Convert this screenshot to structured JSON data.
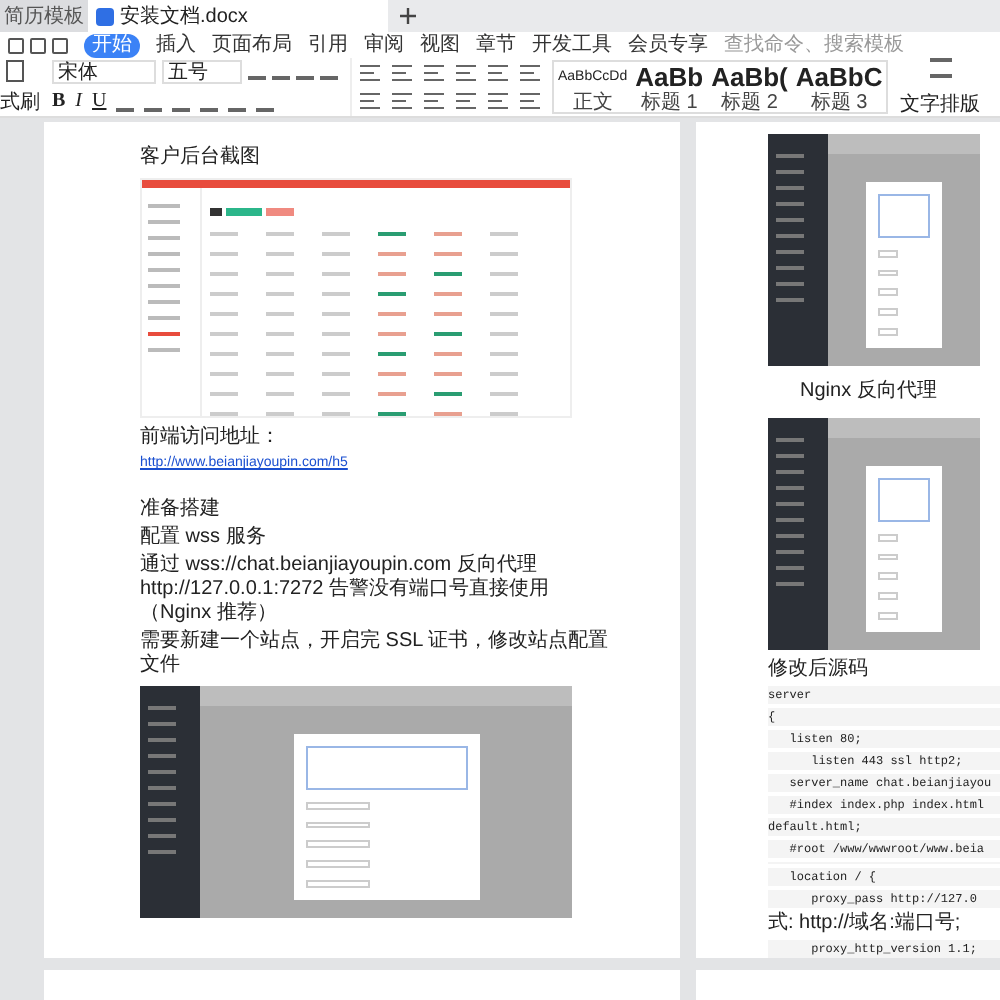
{
  "tabs": [
    {
      "label": "简历模板",
      "selected": false,
      "icon": false
    },
    {
      "label": "安装文档.docx",
      "selected": true,
      "icon": true
    }
  ],
  "menu": [
    {
      "label": "开始",
      "selected": true
    },
    {
      "label": "插入",
      "selected": false
    },
    {
      "label": "页面布局",
      "selected": false
    },
    {
      "label": "引用",
      "selected": false
    },
    {
      "label": "审阅",
      "selected": false
    },
    {
      "label": "视图",
      "selected": false
    },
    {
      "label": "章节",
      "selected": false
    },
    {
      "label": "开发工具",
      "selected": false
    },
    {
      "label": "会员专享",
      "selected": false
    }
  ],
  "search": {
    "placeholder": "查找命令、搜索模板"
  },
  "ribbon": {
    "format_painter": "式刷",
    "font": "宋体",
    "size": "五号",
    "format_buttons": [
      "B",
      "I",
      "U"
    ],
    "styles": [
      {
        "preview": "AaBbCcDd",
        "label": "正文",
        "kind": "body"
      },
      {
        "preview": "AaBb",
        "label": "标题 1",
        "kind": "heading"
      },
      {
        "preview": "AaBb(",
        "label": "标题 2",
        "kind": "heading"
      },
      {
        "preview": "AaBbC",
        "label": "标题 3",
        "kind": "heading"
      }
    ],
    "layout": "文字排版"
  },
  "page_1": [
    {
      "kind": "text",
      "text": "客户后台截图"
    },
    {
      "kind": "admin"
    },
    {
      "kind": "text",
      "text": "前端访问地址："
    },
    {
      "kind": "link",
      "text": "http://www.beianjiayoupin.com/h5"
    },
    {
      "kind": "gap"
    },
    {
      "kind": "text",
      "text": "准备搭建"
    },
    {
      "kind": "text",
      "text": "配置 wss 服务"
    },
    {
      "kind": "text",
      "text": "通过 wss://chat.beianjiayoupin.com 反向代理 http://127.0.0.1:7272 告警没有端口号直接使用（Nginx 推荐）"
    },
    {
      "kind": "text",
      "text": "需要新建一个站点，开启完 SSL 证书，修改站点配置文件"
    },
    {
      "kind": "panel"
    }
  ],
  "page_2": [
    {
      "kind": "panel"
    },
    {
      "kind": "title",
      "text": "Nginx 反向代理"
    },
    {
      "kind": "panel"
    },
    {
      "kind": "text",
      "text": "修改后源码"
    },
    {
      "kind": "code",
      "text": "server"
    },
    {
      "kind": "code",
      "text": "{"
    },
    {
      "kind": "code",
      "text": "   listen 80;"
    },
    {
      "kind": "code",
      "text": "      listen 443 ssl http2;"
    },
    {
      "kind": "code",
      "text": "   server_name chat.beianjiayou"
    },
    {
      "kind": "code",
      "text": "   #index index.php index.html"
    },
    {
      "kind": "code",
      "text": "default.html;"
    },
    {
      "kind": "code",
      "text": "   #root /www/wwwroot/www.beia"
    },
    {
      "kind": "blank"
    },
    {
      "kind": "code",
      "text": "   location / {"
    },
    {
      "kind": "code",
      "text": "      proxy_pass http://127.0"
    },
    {
      "kind": "text",
      "text": "式: http://域名:端口号;"
    },
    {
      "kind": "code",
      "text": "      proxy_http_version 1.1;"
    }
  ]
}
